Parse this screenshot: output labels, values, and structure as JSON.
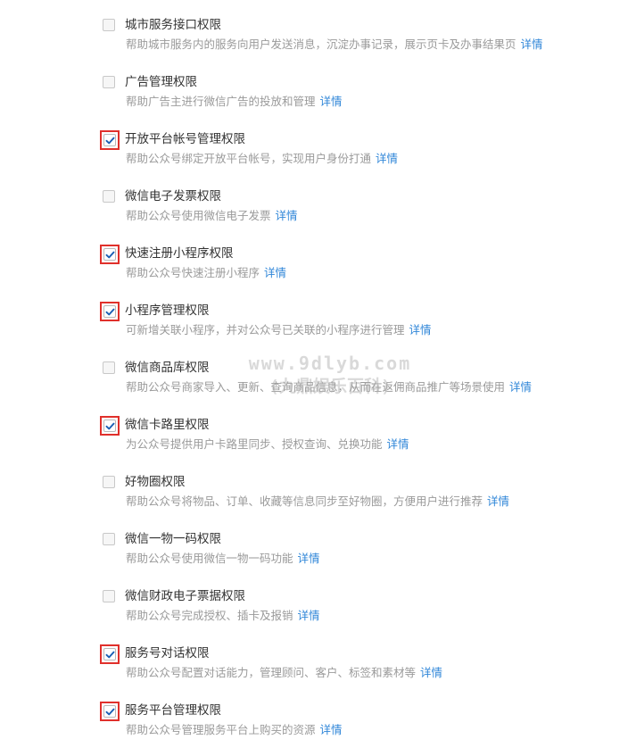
{
  "permissions": [
    {
      "title": "城市服务接口权限",
      "desc": "帮助城市服务内的服务向用户发送消息，沉淀办事记录，展示页卡及办事结果页",
      "link": "详情",
      "checked": false
    },
    {
      "title": "广告管理权限",
      "desc": "帮助广告主进行微信广告的投放和管理",
      "link": "详情",
      "checked": false
    },
    {
      "title": "开放平台帐号管理权限",
      "desc": "帮助公众号绑定开放平台帐号，实现用户身份打通",
      "link": "详情",
      "checked": true
    },
    {
      "title": "微信电子发票权限",
      "desc": "帮助公众号使用微信电子发票",
      "link": "详情",
      "checked": false
    },
    {
      "title": "快速注册小程序权限",
      "desc": "帮助公众号快速注册小程序",
      "link": "详情",
      "checked": true
    },
    {
      "title": "小程序管理权限",
      "desc": "可新增关联小程序，并对公众号已关联的小程序进行管理",
      "link": "详情",
      "checked": true
    },
    {
      "title": "微信商品库权限",
      "desc": "帮助公众号商家导入、更新、查询商品信息，从而在返佣商品推广等场景使用",
      "link": "详情",
      "checked": false
    },
    {
      "title": "微信卡路里权限",
      "desc": "为公众号提供用户卡路里同步、授权查询、兑换功能",
      "link": "详情",
      "checked": true
    },
    {
      "title": "好物圈权限",
      "desc": "帮助公众号将物品、订单、收藏等信息同步至好物圈，方便用户进行推荐",
      "link": "详情",
      "checked": false
    },
    {
      "title": "微信一物一码权限",
      "desc": "帮助公众号使用微信一物一码功能",
      "link": "详情",
      "checked": false
    },
    {
      "title": "微信财政电子票据权限",
      "desc": "帮助公众号完成授权、插卡及报销",
      "link": "详情",
      "checked": false
    },
    {
      "title": "服务号对话权限",
      "desc": "帮助公众号配置对话能力，管理顾问、客户、标签和素材等",
      "link": "详情",
      "checked": true
    },
    {
      "title": "服务平台管理权限",
      "desc": "帮助公众号管理服务平台上购买的资源",
      "link": "详情",
      "checked": true
    }
  ],
  "watermark": {
    "line1": "www.9dlyb.com",
    "line2": "(九鼎娱乐百科)"
  },
  "colors": {
    "highlight": "#e0302b",
    "link": "#2f86d8",
    "check": "#1a5fb4"
  }
}
